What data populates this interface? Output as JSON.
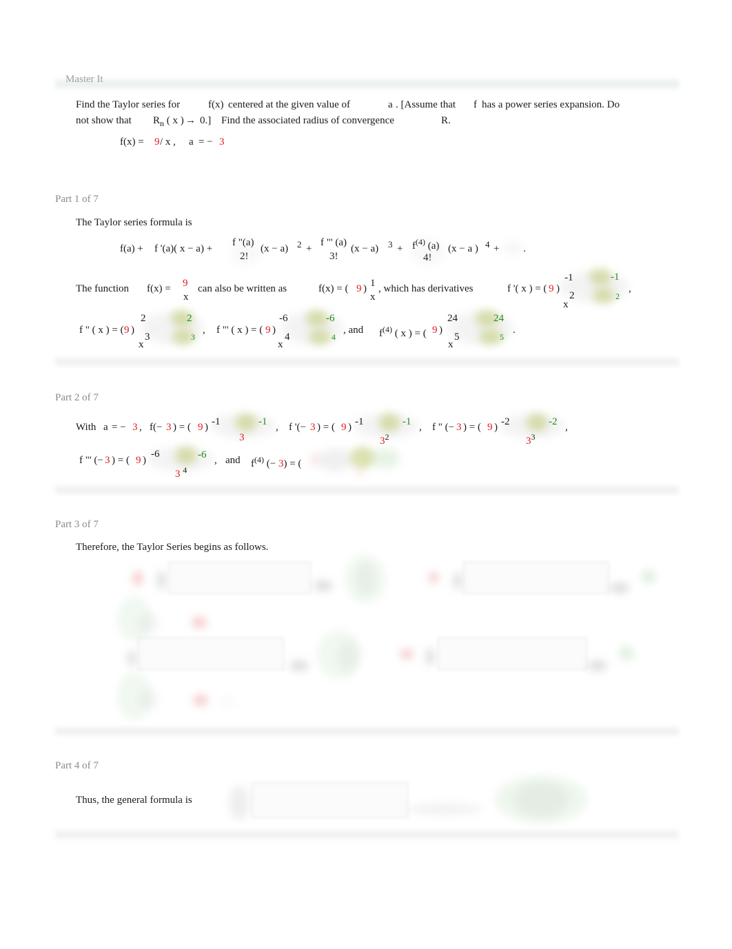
{
  "header": {
    "title": "Master It"
  },
  "problem": {
    "line1": {
      "t1": "Find the Taylor series for",
      "fx": "f(x)",
      "t2": "centered at the given value of",
      "a": "a",
      "t3": ". [Assume that",
      "f": "f",
      "t4": "has a power series expansion. Do"
    },
    "line2": {
      "t1": "not show that",
      "rn": "R",
      "rn_sub": "n",
      "rn_arg": "( x )",
      "arrow": "→",
      "t2": "0.]",
      "t3": "Find the associated radius of convergence",
      "r": "R."
    },
    "given": {
      "fx": "f(x) =",
      "numer": "9",
      "rest": "/ x ,",
      "a_label": "a",
      "eq": "= −",
      "a_value": "3"
    }
  },
  "parts": [
    {
      "title": "Part 1 of 7",
      "intro": "The Taylor series formula is",
      "formula": {
        "t0": "f(a) +",
        "t1": "f '(a)( x  −  a) +",
        "d2_num": "f \"(a)",
        "d2_den": "2!",
        "p2": "(x −  a)",
        "e2": "2",
        "plus2": "+",
        "d3_num": "f \"' (a)",
        "d3_den": "3!",
        "p3": "(x  −  a)",
        "e3": "3",
        "plus3": "+",
        "d4_f": "f",
        "d4_sup": "(4)",
        "d4_arg": "(a)",
        "d4_den": "4!",
        "p4": "(x  −  a )",
        "e4": "4",
        "plus4": "+",
        "end": "."
      },
      "function_line": {
        "t1": "The function",
        "fx": "f(x) =",
        "numer": "9",
        "denom": "x",
        "t2": "can also be written as",
        "fx2": "f(x) = (",
        "coef": "9",
        "close": ")",
        "frac_num": "1",
        "frac_den": "x",
        "t3": ",   which has derivatives",
        "d1_label": "f '( x ) = (",
        "d1_coef": "9",
        "d1_close": ")",
        "d1_num": "-1",
        "d1_den_x": "x",
        "d1_den_exp": "2",
        "d1_ans_num": "-1",
        "d1_ans_exp": "2",
        "comma": ","
      },
      "derivatives_line": [
        {
          "label": "f \" ( x ) = (",
          "coef": "9",
          "close": ")",
          "num": "2",
          "den_x": "x",
          "den_exp": "3",
          "ans_num": "2",
          "ans_exp": "3",
          "after": ","
        },
        {
          "label": "f \"' ( x ) = (",
          "coef": "9",
          "close": ")",
          "num": "-6",
          "den_x": "x",
          "den_exp": "4",
          "ans_num": "-6",
          "ans_exp": "4",
          "after": ",   and"
        },
        {
          "label_f": "f",
          "label_sup": "(4)",
          "label_rest": "( x ) = (",
          "coef": "9",
          "close": ")",
          "num": "24",
          "den_x": "x",
          "den_exp": "5",
          "ans_num": "24",
          "ans_exp": "5",
          "after": "."
        }
      ]
    },
    {
      "title": "Part 2 of 7",
      "line1": {
        "with": "With",
        "a": "a",
        "eq": "= −",
        "a_val": "3",
        "comma": ",",
        "items": [
          {
            "label_pre": "f(−",
            "arg": "3",
            "label_post": ") = (",
            "coef": "9",
            "close": ")",
            "num": "-1",
            "den_base": "3",
            "den_exp": "",
            "ans": "-1",
            "after": ","
          },
          {
            "label_pre": "f '(−",
            "arg": "3",
            "label_post": ") = (",
            "coef": "9",
            "close": ")",
            "num": "-1",
            "den_base": "3",
            "den_exp": "2",
            "ans": "-1",
            "after": ","
          },
          {
            "label_pre": "f \" (−",
            "arg": "3",
            "label_post": ") = (",
            "coef": "9",
            "close": ")",
            "num": "-2",
            "den_base": "3",
            "den_exp": "3",
            "ans": "-2",
            "after": ","
          }
        ]
      },
      "line2": {
        "item": {
          "label_pre": "f \"' (−",
          "arg": "3",
          "label_post": ") = (",
          "coef": "9",
          "close": ")",
          "num": "-6",
          "den_base": "3",
          "den_exp": "4",
          "ans": "-6",
          "after": ","
        },
        "and": "and",
        "f4_f": "f",
        "f4_sup": "(4)",
        "f4_pre": "(−",
        "f4_arg": "3",
        "f4_post": ") = ("
      }
    },
    {
      "title": "Part 3 of 7",
      "intro": "Therefore, the Taylor Series begins as follows."
    },
    {
      "title": "Part 4 of 7",
      "intro": "Thus, the general formula is"
    }
  ]
}
